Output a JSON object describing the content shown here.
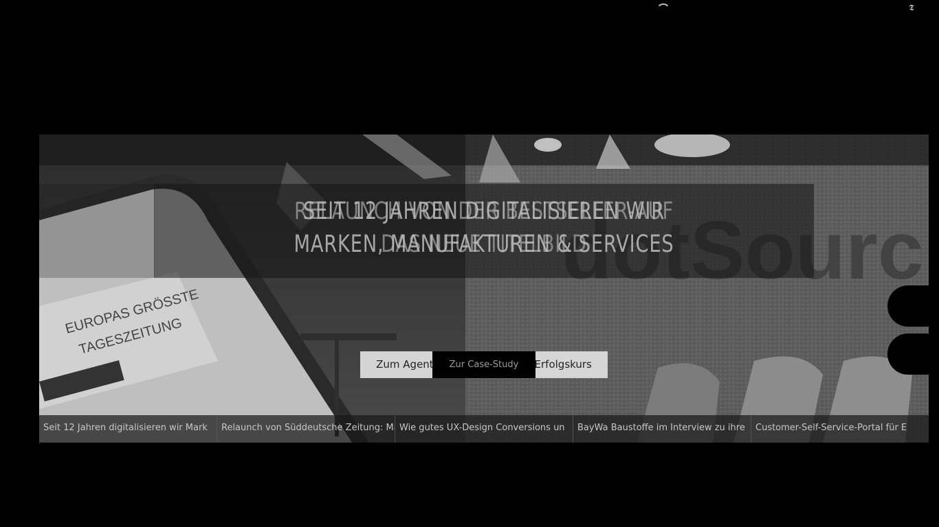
{
  "topbar": {
    "loading_icon": "spinner-icon",
    "corner_icon_glyph": "𝕿"
  },
  "slider": {
    "headline_a_line1": "SEIT 12 JAHREN DIGITALISIEREN WIR",
    "headline_a_line2": "MARKEN, MANUFAKTUREN & SERVICES",
    "headline_b_line1": "RELAUNCH VON DER BESTSELLER-AUF",
    "headline_b_line2": "DAS NEUE TITELBILD",
    "cta_light": "Zum Agenturjubiläum: Mit auf Erfolgskurs",
    "cta_dark": "Zur Case-Study",
    "tabs": [
      "Seit 12 Jahren digitalisieren wir Mark",
      "Relaunch von Süddeutsche Zeitung: Mage",
      "Wie gutes UX-Design Conversions un",
      "BayWa Baustoffe im Interview zu ihre",
      "Customer-Self-Service-Portal für E"
    ]
  }
}
